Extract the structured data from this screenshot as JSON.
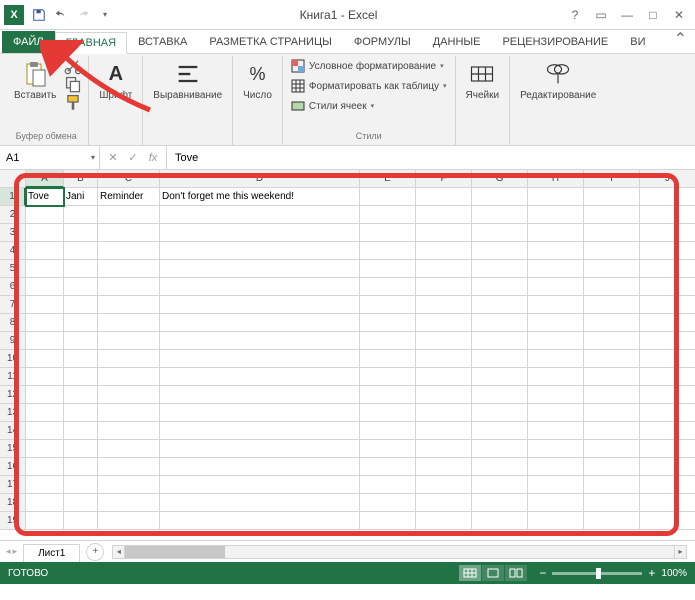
{
  "titlebar": {
    "title": "Книга1 - Excel"
  },
  "tabs": {
    "file": "ФАЙЛ",
    "items": [
      "ГЛАВНАЯ",
      "ВСТАВКА",
      "РАЗМЕТКА СТРАНИЦЫ",
      "ФОРМУЛЫ",
      "ДАННЫЕ",
      "РЕЦЕНЗИРОВАНИЕ",
      "ВИ"
    ]
  },
  "ribbon": {
    "clipboard": {
      "paste": "Вставить",
      "label": "Буфер обмена"
    },
    "font": {
      "btn": "Шрифт"
    },
    "alignment": {
      "btn": "Выравнивание"
    },
    "number": {
      "btn": "Число"
    },
    "styles": {
      "cond": "Условное форматирование",
      "table": "Форматировать как таблицу",
      "cell": "Стили ячеек",
      "label": "Стили"
    },
    "cells": {
      "btn": "Ячейки"
    },
    "editing": {
      "btn": "Редактирование"
    }
  },
  "formulabar": {
    "namebox": "A1",
    "fx": "fx",
    "value": "Tove"
  },
  "grid": {
    "cols": [
      "A",
      "B",
      "C",
      "D",
      "E",
      "F",
      "G",
      "H",
      "I",
      "J"
    ],
    "rows": 19,
    "data": {
      "A1": "Tove",
      "B1": "Jani",
      "C1": "Reminder",
      "D1": "Don't forget me this weekend!"
    },
    "selected": "A1"
  },
  "sheets": {
    "active": "Лист1"
  },
  "statusbar": {
    "status": "Готово",
    "zoom": "100%"
  }
}
